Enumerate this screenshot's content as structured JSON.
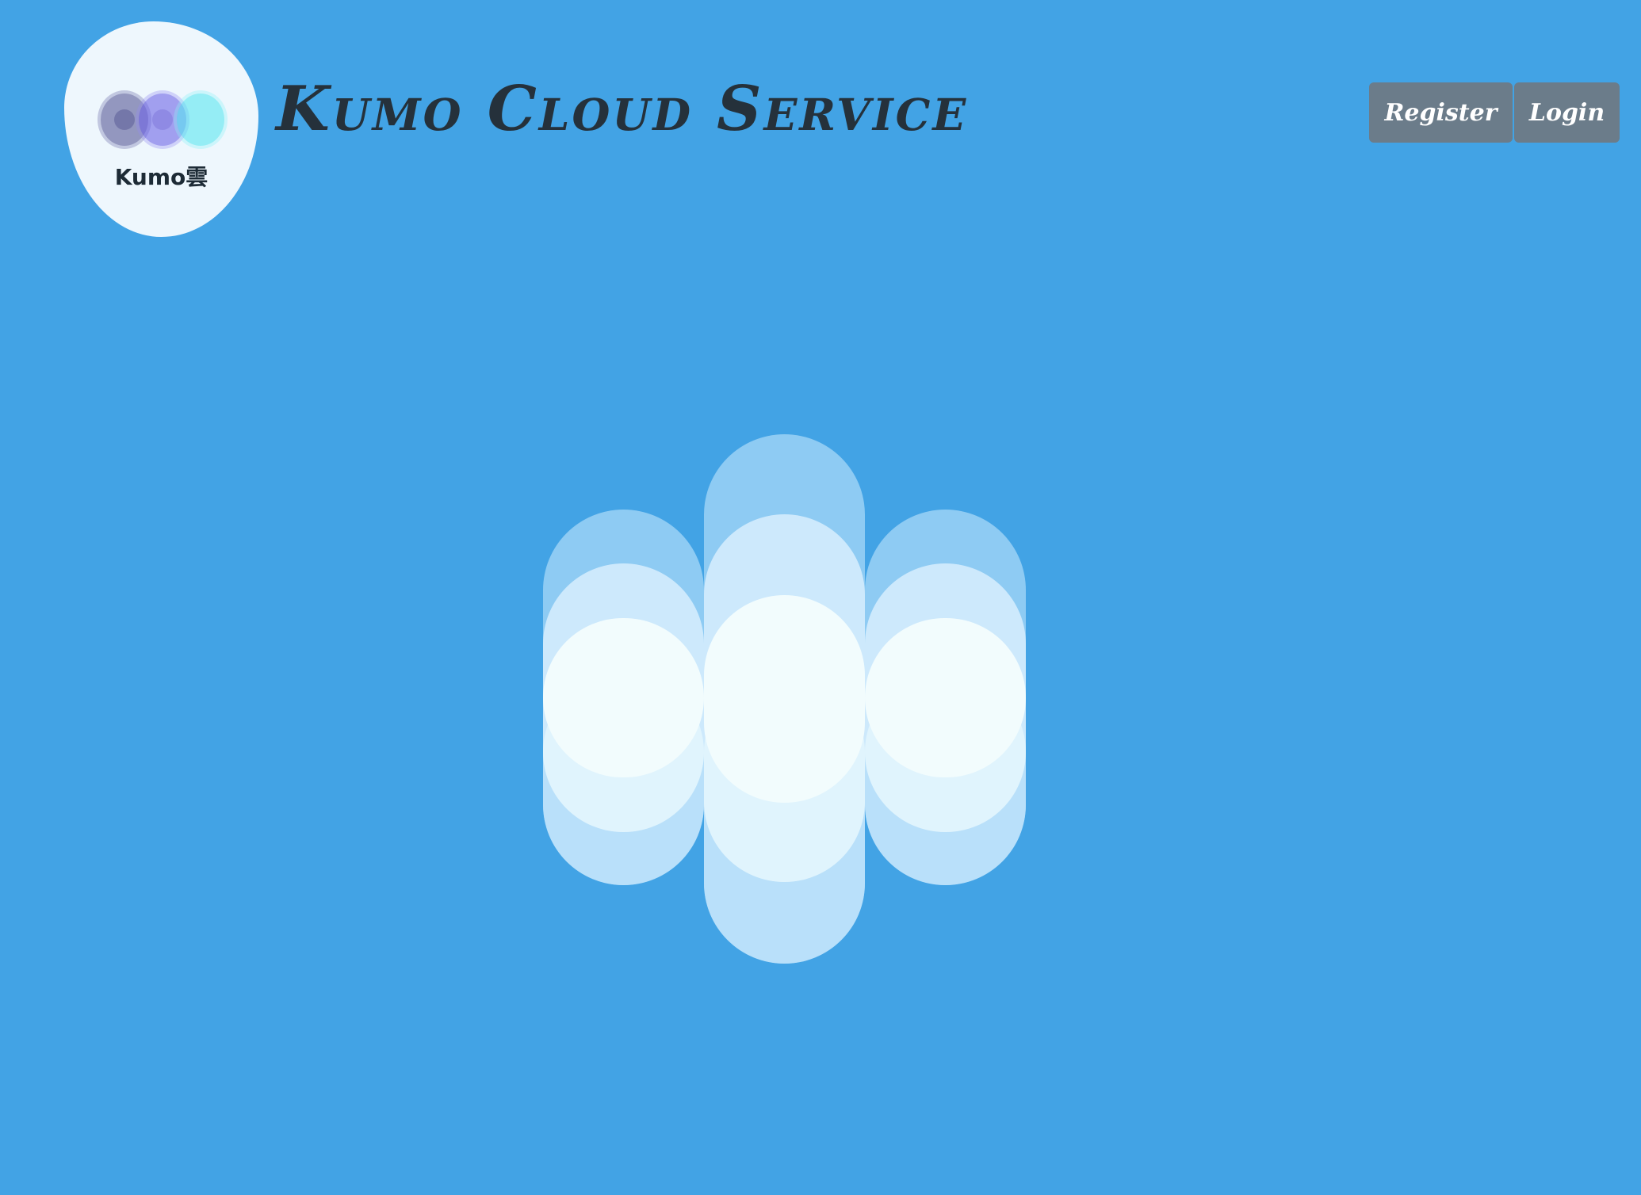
{
  "header": {
    "logo_text": "Kumo雲",
    "title": "Kumo Cloud Service",
    "nav": {
      "register_label": "Register",
      "login_label": "Login"
    }
  },
  "colors": {
    "background": "#42a3e5",
    "title_text": "#25313b",
    "button_bg": "#6b7c8a",
    "button_text": "#ffffff",
    "cloud_light": "#f2fcfd",
    "cloud_mid": "#cde9fc",
    "cloud_outer": "#8ecbf3"
  },
  "icons": {
    "logo": "kumo-logo-icon",
    "hero": "cloud-illustration-icon"
  }
}
